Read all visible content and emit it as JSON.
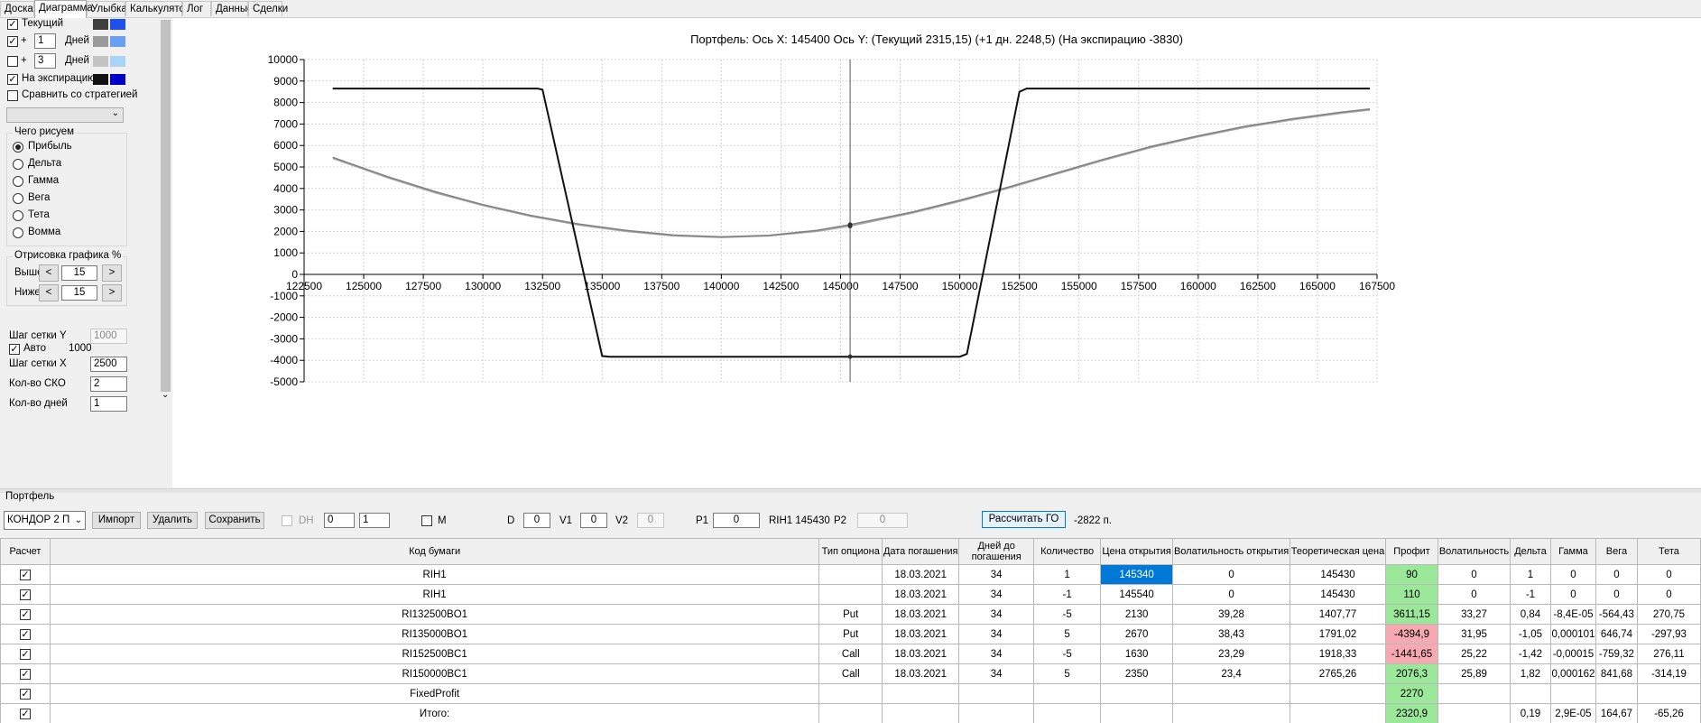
{
  "tabs": [
    "Доска",
    "Диаграмма",
    "Улыбка",
    "Калькулятор",
    "Лог",
    "Данные",
    "Сделки"
  ],
  "active_tab": "Диаграмма",
  "left": {
    "rows": [
      {
        "checked": true,
        "label": "Текущий",
        "plus": "",
        "value": "",
        "unit": "",
        "colors": [
          "#3f3f3f",
          "#1e50f0"
        ]
      },
      {
        "checked": true,
        "label": "",
        "plus": "+",
        "value": "1",
        "unit": "Дней",
        "colors": [
          "#9a9a9a",
          "#6b9ff0"
        ]
      },
      {
        "checked": false,
        "label": "",
        "plus": "+",
        "value": "3",
        "unit": "Дней",
        "colors": [
          "#c4c4c4",
          "#a9d4f5"
        ]
      },
      {
        "checked": true,
        "label": "На экспирацию",
        "plus": "",
        "value": "",
        "unit": "",
        "colors": [
          "#111111",
          "#0000c8"
        ]
      }
    ],
    "compare_label": "Сравнить со стратегией",
    "what_group": "Чего рисуем",
    "options": [
      "Прибыль",
      "Дельта",
      "Гамма",
      "Вега",
      "Тета",
      "Вомма"
    ],
    "selected_option": "Прибыль",
    "render_group": "Отрисовка графика %",
    "above_label": "Выше",
    "above_value": "15",
    "below_label": "Ниже",
    "below_value": "15",
    "grid_y_label": "Шаг сетки Y",
    "grid_y_value": "1000",
    "auto_label": "Авто",
    "auto_value": "1000",
    "grid_x_label": "Шаг сетки X",
    "grid_x_value": "2500",
    "sko_label": "Кол-во СКО",
    "sko_value": "2",
    "days_label": "Кол-во дней",
    "days_value": "1"
  },
  "chart_title": "Портфель: Ось X: 145400 Ось Y:  (Текущий 2315,15)  (+1 дн. 2248,5)  (На экспирацию -3830)",
  "chart_data": {
    "type": "line",
    "title": "Портфель: Ось X: 145400 Ось Y:  (Текущий 2315,15)  (+1 дн. 2248,5)  (На экспирацию -3830)",
    "xlim": [
      122500,
      167500
    ],
    "ylim": [
      -5000,
      10000
    ],
    "x_ticks": [
      122500,
      125000,
      127500,
      130000,
      132500,
      135000,
      137500,
      140000,
      142500,
      145000,
      147500,
      150000,
      152500,
      155000,
      157500,
      160000,
      162500,
      165000,
      167500
    ],
    "y_ticks": [
      10000,
      9000,
      8000,
      7000,
      6000,
      5000,
      4000,
      3000,
      2000,
      1000,
      0,
      -1000,
      -2000,
      -3000,
      -4000,
      -5000
    ],
    "cursor_x": 145400,
    "series": [
      {
        "color": "#111111",
        "x": [
          123700,
          132300,
          132500,
          135000,
          135300,
          150000,
          150300,
          152500,
          152800,
          167200
        ],
        "y": [
          8650,
          8650,
          8600,
          -3800,
          -3830,
          -3830,
          -3700,
          8500,
          8650,
          8650
        ]
      },
      {
        "color": "#7f7f7f",
        "x": [
          123700,
          126000,
          128000,
          130000,
          132000,
          134000,
          136000,
          138000,
          140000,
          142000,
          144000,
          145400,
          148000,
          150000,
          152000,
          154000,
          156000,
          158000,
          160000,
          162000,
          164000,
          166000,
          167200
        ],
        "y": [
          5450,
          4550,
          3850,
          3250,
          2750,
          2350,
          2050,
          1830,
          1750,
          1820,
          2050,
          2315,
          2900,
          3450,
          4050,
          4700,
          5350,
          5950,
          6450,
          6900,
          7250,
          7550,
          7700
        ]
      },
      {
        "color": "#a8a8a8",
        "x": [
          123700,
          126000,
          128000,
          130000,
          132000,
          134000,
          136000,
          138000,
          140000,
          142000,
          144000,
          145400,
          148000,
          150000,
          152000,
          154000,
          156000,
          158000,
          160000,
          162000,
          164000,
          166000,
          167200
        ],
        "y": [
          5400,
          4500,
          3800,
          3200,
          2700,
          2300,
          2000,
          1790,
          1720,
          1790,
          2000,
          2249,
          2850,
          3400,
          4000,
          4650,
          5300,
          5900,
          6400,
          6850,
          7200,
          7500,
          7650
        ]
      }
    ]
  },
  "portfolio": {
    "label": "Портфель",
    "strategy": "КОНДОР 2 П",
    "import": "Импорт",
    "delete": "Удалить",
    "save": "Сохранить",
    "dh": "DH",
    "spin1": "0",
    "spin2": "1",
    "m": "M",
    "d_label": "D",
    "d_value": "0",
    "v1_label": "V1",
    "v1_value": "0",
    "v2_label": "V2",
    "v2_value": "0",
    "p1_label": "P1",
    "p1_value": "0",
    "ticker": "RIH1 145430",
    "p2_label": "P2",
    "p2_value": "0",
    "calc_button": "Рассчитать ГО",
    "go_value": "-2822 п."
  },
  "table": {
    "headers": [
      "Расчет",
      "Код бумаги",
      "Тип опциона",
      "Дата погашения",
      "Дней до погашения",
      "Количество",
      "Цена открытия",
      "Волатильность открытия",
      "Теоретическая цена",
      "Профит",
      "Волатильность",
      "Дельта",
      "Гамма",
      "Вега",
      "Тета"
    ],
    "rows": [
      [
        "RIH1",
        "",
        "18.03.2021",
        "34",
        "1",
        "145340",
        "0",
        "145430",
        "90",
        "0",
        "1",
        "0",
        "0",
        "0"
      ],
      [
        "RIH1",
        "",
        "18.03.2021",
        "34",
        "-1",
        "145540",
        "0",
        "145430",
        "110",
        "0",
        "-1",
        "0",
        "0",
        "0"
      ],
      [
        "RI132500BO1",
        "Put",
        "18.03.2021",
        "34",
        "-5",
        "2130",
        "39,28",
        "1407,77",
        "3611,15",
        "33,27",
        "0,84",
        "-8,4E-05",
        "-564,43",
        "270,75"
      ],
      [
        "RI135000BO1",
        "Put",
        "18.03.2021",
        "34",
        "5",
        "2670",
        "38,43",
        "1791,02",
        "-4394,9",
        "31,95",
        "-1,05",
        "0,000101",
        "646,74",
        "-297,93"
      ],
      [
        "RI152500BC1",
        "Call",
        "18.03.2021",
        "34",
        "-5",
        "1630",
        "23,29",
        "1918,33",
        "-1441,65",
        "25,22",
        "-1,42",
        "-0,00015",
        "-759,32",
        "276,11"
      ],
      [
        "RI150000BC1",
        "Call",
        "18.03.2021",
        "34",
        "5",
        "2350",
        "23,4",
        "2765,26",
        "2076,3",
        "25,89",
        "1,82",
        "0,000162",
        "841,68",
        "-314,19"
      ],
      [
        "FixedProfit",
        "",
        "",
        "",
        "",
        "",
        "",
        "",
        "2270",
        "",
        "",
        "",
        "",
        ""
      ],
      [
        "Итого:",
        "",
        "",
        "",
        "",
        "",
        "",
        "",
        "2320,9",
        "",
        "0,19",
        "2,9E-05",
        "164,67",
        "-65,26"
      ]
    ]
  }
}
